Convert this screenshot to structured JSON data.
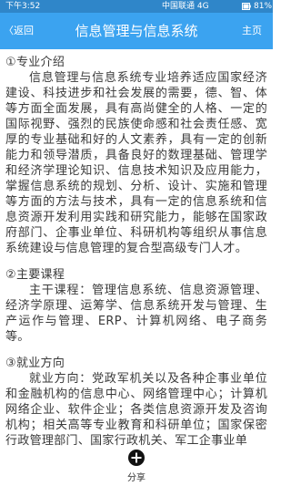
{
  "status_bar": {
    "time": "下午3:52",
    "carrier": "中国联通 4G",
    "battery": "81%"
  },
  "header": {
    "back_label": "〈返回",
    "title": "信息管理与信息系统",
    "home_label": "主页"
  },
  "sections": [
    {
      "heading": "①专业介绍",
      "body": "信息管理与信息系统专业培养适应国家经济建设、科技进步和社会发展的需要，德、智、体等方面全面发展，具有高尚健全的人格、一定的国际视野、强烈的民族使命感和社会责任感、宽厚的专业基础和好的人文素养，具有一定的创新能力和领导潜质，具备良好的数理基础、管理学和经济学理论知识、信息技术知识及应用能力，掌握信息系统的规划、分析、设计、实施和管理等方面的方法与技术，具有一定的信息系统和信息资源开发利用实践和研究能力，能够在国家政府部门、企事业单位、科研机构等组织从事信息系统建设与信息管理的复合型高级专门人才。"
    },
    {
      "heading": "②主要课程",
      "body": "主干课程：管理信息系统、信息资源管理、经济学原理、运筹学、信息系统开发与管理、生产运作与管理、ERP、计算机网络、电子商务等。"
    },
    {
      "heading": "③就业方向",
      "body": "就业方向：党政军机关以及各种企事业单位和金融机构的信息中心、网络管理中心；计算机网络企业、软件企业；各类信息资源开发及咨询机构；相关高等专业教育和科研单位；国家保密行政管理部门、国家行政机关、军工企事业单"
    }
  ],
  "footer": {
    "share_label": "分享"
  },
  "colors": {
    "status_bar": "#2f86c9",
    "title_bar": "#3ba3f0",
    "text": "#3a3a3a"
  }
}
